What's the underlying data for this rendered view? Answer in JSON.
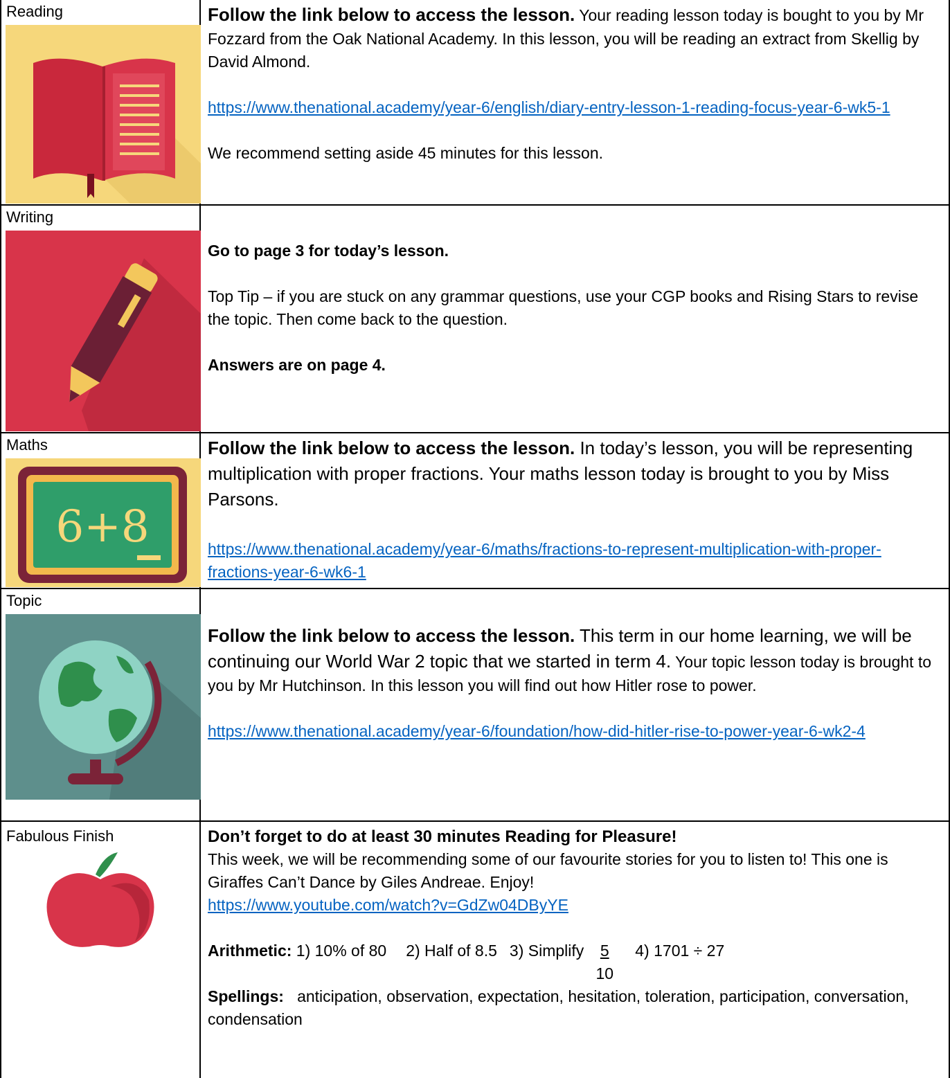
{
  "reading": {
    "label": "Reading",
    "bold": "Follow the link below to access the lesson.",
    "text1": " Your reading lesson today is bought to you by Mr Fozzard from the Oak National Academy. In this lesson, you will be reading an extract from Skellig by David Almond.",
    "link": "https://www.thenational.academy/year-6/english/diary-entry-lesson-1-reading-focus-year-6-wk5-1",
    "time": "We recommend setting aside 45 minutes for this lesson."
  },
  "writing": {
    "label": "Writing",
    "goto": "Go to page 3 for today’s lesson.",
    "tip": "Top Tip – if you are stuck on any grammar questions, use your CGP books and Rising Stars to revise the topic. Then come back to the question.",
    "answers": "Answers are on page 4."
  },
  "maths": {
    "label": "Maths",
    "bold": "Follow the link below to access the lesson.",
    "text1": " In today’s lesson, you will be representing multiplication with proper fractions. Your maths lesson today is brought to you by Miss Parsons.",
    "link": "https://www.thenational.academy/year-6/maths/fractions-to-represent-multiplication-with-proper-fractions-year-6-wk6-1",
    "board_text": "6+8"
  },
  "topic": {
    "label": "Topic",
    "bold": "Follow the link below to access the lesson.",
    "text_big": " This term in our home learning, we will be continuing our World War 2 topic that we started in term 4.",
    "text_small": " Your topic lesson today is brought to you by Mr Hutchinson. In this lesson you will find out how Hitler rose to power.",
    "link": "https://www.thenational.academy/year-6/foundation/how-did-hitler-rise-to-power-year-6-wk2-4"
  },
  "finish": {
    "label": "Fabulous Finish",
    "bold": "Don’t forget to do at least 30 minutes Reading for Pleasure!",
    "line1": "This week, we will be recommending some of our favourite stories for you to listen to! This one is Giraffes Can’t Dance by Giles Andreae. Enjoy!",
    "link": "https://www.youtube.com/watch?v=GdZw04DByYE",
    "arith_label": "Arithmetic:",
    "q1": " 1) 10% of 80",
    "q2": "2) Half of 8.5",
    "q3": "3) Simplify",
    "frac_num": "5",
    "frac_den": "10",
    "q4": "4) 1701 ÷ 27",
    "spell_label": "Spellings:",
    "spell_words": "anticipation, observation, expectation, hesitation, toleration, participation, conversation, condensation"
  },
  "colors": {
    "link": "#0563c1",
    "book_bg": "#f6d77b",
    "writing_bg": "#d8344a",
    "maths_bg": "#f6d77b",
    "topic_bg": "#5e8f8c",
    "apple": "#d8344a"
  }
}
